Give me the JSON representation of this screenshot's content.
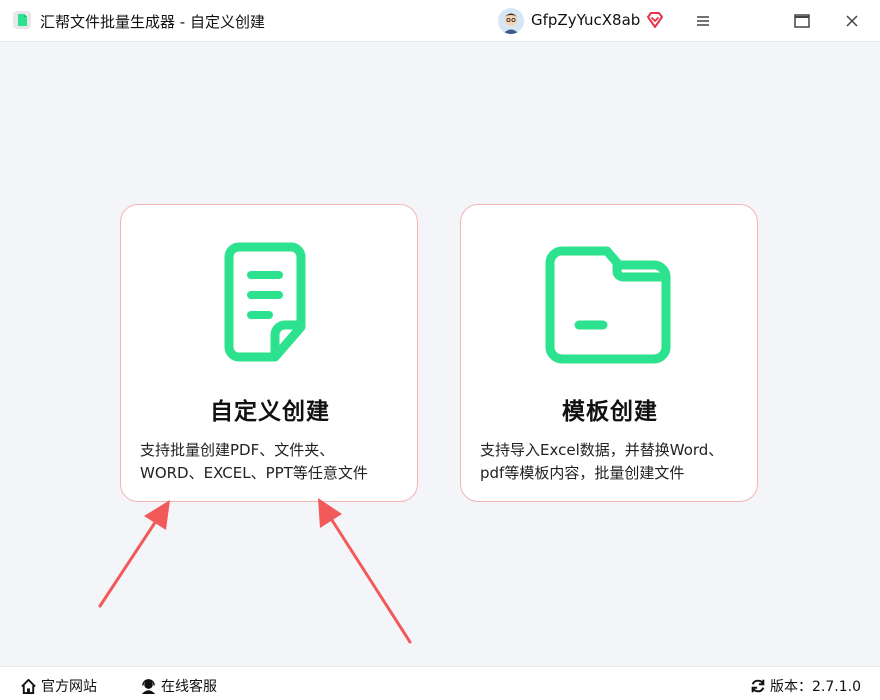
{
  "window": {
    "title": "汇帮文件批量生成器 - 自定义创建",
    "username": "GfpZyYucX8ab"
  },
  "cards": [
    {
      "id": "custom",
      "title": "自定义创建",
      "desc_line1": "支持批量创建PDF、文件夹、",
      "desc_line2": "WORD、EXCEL、PPT等任意文件",
      "icon": "document-icon"
    },
    {
      "id": "template",
      "title": "模板创建",
      "desc_line1": "支持导入Excel数据，并替换Word、",
      "desc_line2": "pdf等模板内容，批量创建文件",
      "icon": "folder-icon"
    }
  ],
  "footer": {
    "website_label": "官方网站",
    "service_label": "在线客服",
    "version_label": "版本：2.7.1.0"
  },
  "colors": {
    "accent": "#2de28e",
    "card_border": "#f3b4b4",
    "arrow": "#f25a5a",
    "background": "#f4f5f9",
    "vip": "#e8334a"
  }
}
